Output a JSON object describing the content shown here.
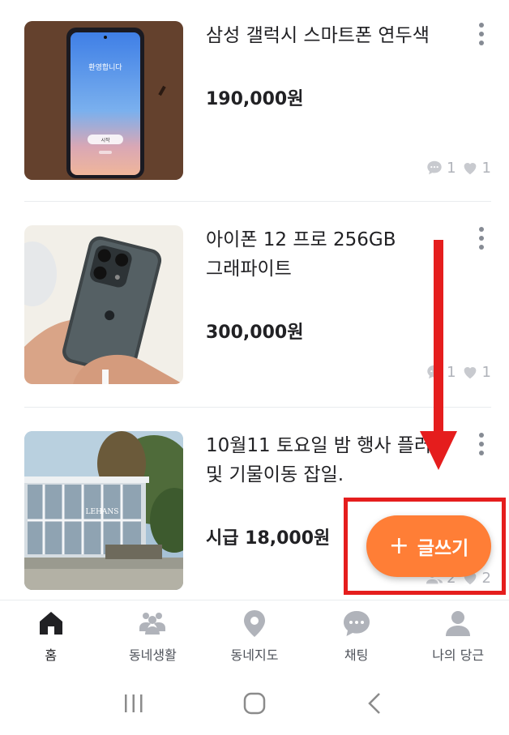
{
  "listings": [
    {
      "title": "삼성 갤럭시 스마트폰 연두색",
      "price": "190,000원",
      "screen_text_1": "환영합니다",
      "screen_text_2": "시작",
      "chat_count": "1",
      "like_count": "1"
    },
    {
      "title": "아이폰 12 프로 256GB 그래파이트",
      "price": "300,000원",
      "chat_count": "1",
      "like_count": "1"
    },
    {
      "title": "10월11 토요일 밤 행사 플러 및 기물이동 잡일.",
      "price": "시급 18,000원",
      "sign_text": "LEHANS",
      "applicant_count": "2",
      "like_count": "2"
    }
  ],
  "fab": {
    "plus": "+",
    "label": "글쓰기"
  },
  "tabbar": {
    "items": [
      {
        "label": "홈",
        "icon": "home-icon"
      },
      {
        "label": "동네생활",
        "icon": "community-icon"
      },
      {
        "label": "동네지도",
        "icon": "map-pin-icon"
      },
      {
        "label": "채팅",
        "icon": "chat-icon"
      },
      {
        "label": "나의 당근",
        "icon": "person-icon"
      }
    ]
  },
  "colors": {
    "accent": "#ff7e36",
    "highlight": "#e51d1d",
    "icon_gray": "#b0b3ba",
    "text": "#212124"
  }
}
